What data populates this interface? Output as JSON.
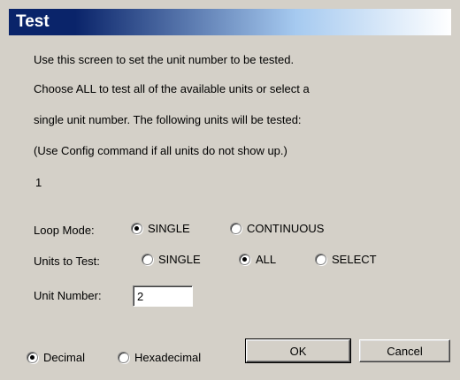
{
  "window": {
    "title": "Test"
  },
  "instructions": {
    "lines": [
      "Use this screen to set the unit number to be tested.",
      "Choose ALL to test all of the available units or select a",
      "single unit number.  The following units will be tested:",
      "(Use Config command if all units do not show up.)"
    ],
    "units_list": "1"
  },
  "loop_mode": {
    "label": "Loop Mode:",
    "options": [
      "SINGLE",
      "CONTINUOUS"
    ],
    "selected": "SINGLE"
  },
  "units_to_test": {
    "label": "Units to Test:",
    "options": [
      "SINGLE",
      "ALL",
      "SELECT"
    ],
    "selected": "ALL"
  },
  "unit_number": {
    "label": "Unit Number:",
    "value": "2"
  },
  "number_format": {
    "options": [
      "Decimal",
      "Hexadecimal"
    ],
    "selected": "Decimal"
  },
  "buttons": {
    "ok": "OK",
    "cancel": "Cancel"
  }
}
